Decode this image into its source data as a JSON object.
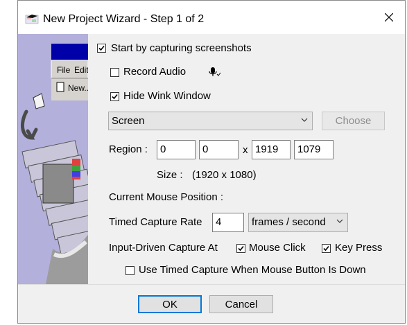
{
  "window": {
    "title": "New Project Wizard - Step 1 of 2"
  },
  "side_image": {
    "menu_file": "File",
    "menu_edit": "Edit",
    "menu_new": "New..."
  },
  "capture": {
    "start_label": "Start by capturing screenshots",
    "start_checked": true,
    "record_audio_label": "Record Audio",
    "record_audio_checked": false,
    "hide_wink_label": "Hide Wink Window",
    "hide_wink_checked": true
  },
  "source": {
    "selected": "Screen",
    "choose_label": "Choose"
  },
  "region": {
    "label": "Region :",
    "x": "0",
    "y": "0",
    "separator": "x",
    "width": "1919",
    "height": "1079",
    "size_label": "Size :",
    "size_value": "(1920 x 1080)"
  },
  "mouse": {
    "label": "Current Mouse Position :"
  },
  "timed": {
    "label": "Timed Capture Rate",
    "rate": "4",
    "unit": "frames / second"
  },
  "input_driven": {
    "label": "Input-Driven Capture At",
    "mouse_click_label": "Mouse Click",
    "mouse_click_checked": true,
    "key_press_label": "Key Press",
    "key_press_checked": true,
    "timed_when_down_label": "Use Timed Capture When Mouse Button Is Down",
    "timed_when_down_checked": false
  },
  "footer": {
    "ok_label": "OK",
    "cancel_label": "Cancel"
  }
}
